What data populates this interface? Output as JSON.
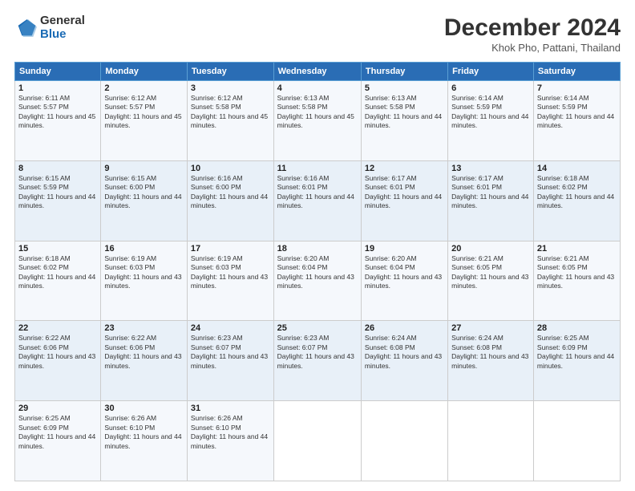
{
  "logo": {
    "general": "General",
    "blue": "Blue"
  },
  "title": {
    "month": "December 2024",
    "location": "Khok Pho, Pattani, Thailand"
  },
  "weekdays": [
    "Sunday",
    "Monday",
    "Tuesday",
    "Wednesday",
    "Thursday",
    "Friday",
    "Saturday"
  ],
  "weeks": [
    [
      {
        "day": 1,
        "rise": "6:11 AM",
        "set": "5:57 PM",
        "daylight": "11 hours and 45 minutes."
      },
      {
        "day": 2,
        "rise": "6:12 AM",
        "set": "5:57 PM",
        "daylight": "11 hours and 45 minutes."
      },
      {
        "day": 3,
        "rise": "6:12 AM",
        "set": "5:58 PM",
        "daylight": "11 hours and 45 minutes."
      },
      {
        "day": 4,
        "rise": "6:13 AM",
        "set": "5:58 PM",
        "daylight": "11 hours and 45 minutes."
      },
      {
        "day": 5,
        "rise": "6:13 AM",
        "set": "5:58 PM",
        "daylight": "11 hours and 44 minutes."
      },
      {
        "day": 6,
        "rise": "6:14 AM",
        "set": "5:59 PM",
        "daylight": "11 hours and 44 minutes."
      },
      {
        "day": 7,
        "rise": "6:14 AM",
        "set": "5:59 PM",
        "daylight": "11 hours and 44 minutes."
      }
    ],
    [
      {
        "day": 8,
        "rise": "6:15 AM",
        "set": "5:59 PM",
        "daylight": "11 hours and 44 minutes."
      },
      {
        "day": 9,
        "rise": "6:15 AM",
        "set": "6:00 PM",
        "daylight": "11 hours and 44 minutes."
      },
      {
        "day": 10,
        "rise": "6:16 AM",
        "set": "6:00 PM",
        "daylight": "11 hours and 44 minutes."
      },
      {
        "day": 11,
        "rise": "6:16 AM",
        "set": "6:01 PM",
        "daylight": "11 hours and 44 minutes."
      },
      {
        "day": 12,
        "rise": "6:17 AM",
        "set": "6:01 PM",
        "daylight": "11 hours and 44 minutes."
      },
      {
        "day": 13,
        "rise": "6:17 AM",
        "set": "6:01 PM",
        "daylight": "11 hours and 44 minutes."
      },
      {
        "day": 14,
        "rise": "6:18 AM",
        "set": "6:02 PM",
        "daylight": "11 hours and 44 minutes."
      }
    ],
    [
      {
        "day": 15,
        "rise": "6:18 AM",
        "set": "6:02 PM",
        "daylight": "11 hours and 44 minutes."
      },
      {
        "day": 16,
        "rise": "6:19 AM",
        "set": "6:03 PM",
        "daylight": "11 hours and 43 minutes."
      },
      {
        "day": 17,
        "rise": "6:19 AM",
        "set": "6:03 PM",
        "daylight": "11 hours and 43 minutes."
      },
      {
        "day": 18,
        "rise": "6:20 AM",
        "set": "6:04 PM",
        "daylight": "11 hours and 43 minutes."
      },
      {
        "day": 19,
        "rise": "6:20 AM",
        "set": "6:04 PM",
        "daylight": "11 hours and 43 minutes."
      },
      {
        "day": 20,
        "rise": "6:21 AM",
        "set": "6:05 PM",
        "daylight": "11 hours and 43 minutes."
      },
      {
        "day": 21,
        "rise": "6:21 AM",
        "set": "6:05 PM",
        "daylight": "11 hours and 43 minutes."
      }
    ],
    [
      {
        "day": 22,
        "rise": "6:22 AM",
        "set": "6:06 PM",
        "daylight": "11 hours and 43 minutes."
      },
      {
        "day": 23,
        "rise": "6:22 AM",
        "set": "6:06 PM",
        "daylight": "11 hours and 43 minutes."
      },
      {
        "day": 24,
        "rise": "6:23 AM",
        "set": "6:07 PM",
        "daylight": "11 hours and 43 minutes."
      },
      {
        "day": 25,
        "rise": "6:23 AM",
        "set": "6:07 PM",
        "daylight": "11 hours and 43 minutes."
      },
      {
        "day": 26,
        "rise": "6:24 AM",
        "set": "6:08 PM",
        "daylight": "11 hours and 43 minutes."
      },
      {
        "day": 27,
        "rise": "6:24 AM",
        "set": "6:08 PM",
        "daylight": "11 hours and 43 minutes."
      },
      {
        "day": 28,
        "rise": "6:25 AM",
        "set": "6:09 PM",
        "daylight": "11 hours and 44 minutes."
      }
    ],
    [
      {
        "day": 29,
        "rise": "6:25 AM",
        "set": "6:09 PM",
        "daylight": "11 hours and 44 minutes."
      },
      {
        "day": 30,
        "rise": "6:26 AM",
        "set": "6:10 PM",
        "daylight": "11 hours and 44 minutes."
      },
      {
        "day": 31,
        "rise": "6:26 AM",
        "set": "6:10 PM",
        "daylight": "11 hours and 44 minutes."
      },
      null,
      null,
      null,
      null
    ]
  ]
}
